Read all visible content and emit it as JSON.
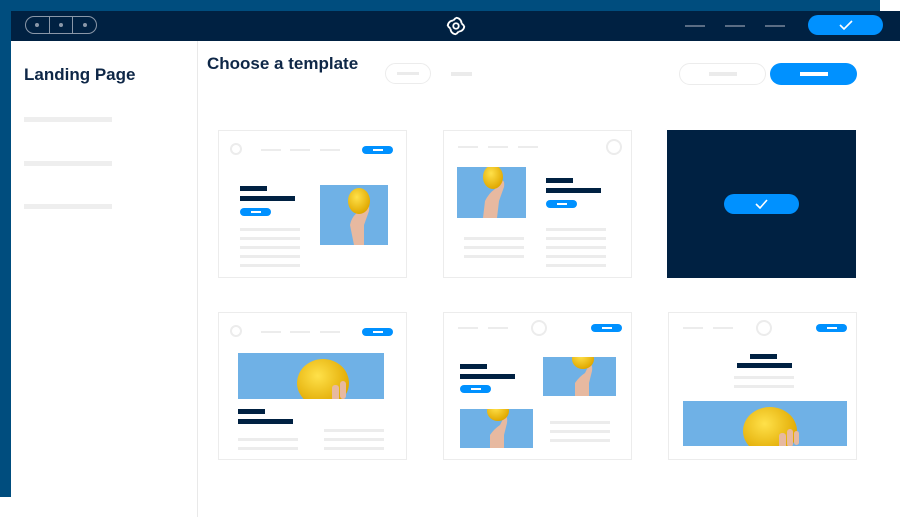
{
  "window": {
    "controls": [
      "dot",
      "dot",
      "dot"
    ],
    "logo_icon": "pinwheel-logo-icon",
    "nav_items": [
      "",
      "",
      ""
    ],
    "confirm_icon": "checkmark-icon"
  },
  "sidebar": {
    "title": "Landing Page",
    "items": [
      "",
      "",
      ""
    ]
  },
  "main": {
    "title": "Choose a template",
    "filter_pill": "",
    "filter_tab": "",
    "secondary_button": "",
    "primary_button": ""
  },
  "templates": [
    {
      "name": "hero-image-right",
      "selected": false
    },
    {
      "name": "hero-image-left",
      "selected": false
    },
    {
      "name": "selected-template",
      "selected": true,
      "icon": "checkmark-icon"
    },
    {
      "name": "banner-top",
      "selected": false
    },
    {
      "name": "two-images-grid",
      "selected": false
    },
    {
      "name": "centered-banner-bottom",
      "selected": false
    }
  ],
  "colors": {
    "frame": "#004d7e",
    "titlebar": "#002142",
    "accent": "#0091ff",
    "heading": "#0e2747",
    "placeholder": "#ececec",
    "photo_sky": "#6fb1e6",
    "lemon": "#f5c518"
  }
}
